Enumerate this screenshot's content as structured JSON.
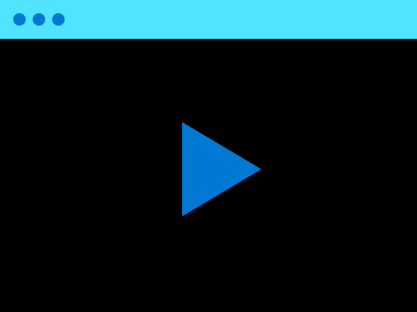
{
  "window": {
    "titlebar_color": "#50e4ff",
    "content_background": "#000000",
    "controls": [
      {
        "icon": "window-dot-icon",
        "color": "#0078d4"
      },
      {
        "icon": "window-dot-icon",
        "color": "#0078d4"
      },
      {
        "icon": "window-dot-icon",
        "color": "#0078d4"
      }
    ]
  },
  "player": {
    "play_icon": "play-icon",
    "play_color": "#0078d4"
  }
}
